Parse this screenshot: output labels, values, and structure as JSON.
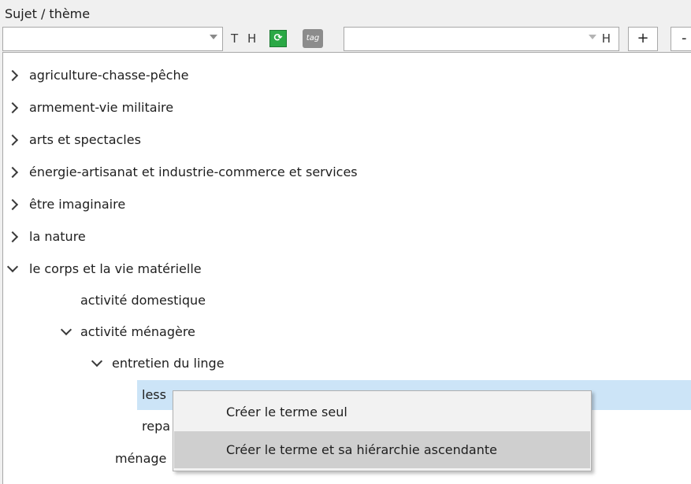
{
  "section": {
    "label": "Sujet / thème"
  },
  "toolbar": {
    "main_combo_value": "",
    "btn_t": "T",
    "btn_h": "H",
    "green_icon": "reload-icon",
    "tag_icon": "tag-icon",
    "tag_text": "tag",
    "secondary_combo_value": "",
    "secondary_h": "H",
    "add_label": "+",
    "remove_label": "-"
  },
  "tree": {
    "items": [
      {
        "label": "agriculture-chasse-pêche",
        "state": "collapsed",
        "level": 0
      },
      {
        "label": "armement-vie militaire",
        "state": "collapsed",
        "level": 0
      },
      {
        "label": "arts et spectacles",
        "state": "collapsed",
        "level": 0
      },
      {
        "label": "énergie-artisanat et industrie-commerce et services",
        "state": "collapsed",
        "level": 0
      },
      {
        "label": "être imaginaire",
        "state": "collapsed",
        "level": 0
      },
      {
        "label": "la nature",
        "state": "collapsed",
        "level": 0
      },
      {
        "label": "le corps et la vie matérielle",
        "state": "expanded",
        "level": 0
      },
      {
        "label": "activité domestique",
        "state": "leaf",
        "level": 1
      },
      {
        "label": "activité ménagère",
        "state": "expanded",
        "level": 1
      },
      {
        "label": "entretien du linge",
        "state": "expanded",
        "level": 2
      },
      {
        "label": "less",
        "state": "leaf",
        "level": 3,
        "selected": true
      },
      {
        "label": "repa",
        "state": "leaf",
        "level": 3
      },
      {
        "label": "ménage",
        "state": "leaf",
        "level": 2
      }
    ]
  },
  "context_menu": {
    "items": [
      {
        "label": "Créer le terme seul",
        "highlighted": false
      },
      {
        "label": "Créer le terme et sa hiérarchie ascendante",
        "highlighted": true
      }
    ]
  },
  "colors": {
    "selection": "#cce4f7",
    "menu_highlight": "#cfcfcf",
    "green_button": "#2aa845"
  }
}
